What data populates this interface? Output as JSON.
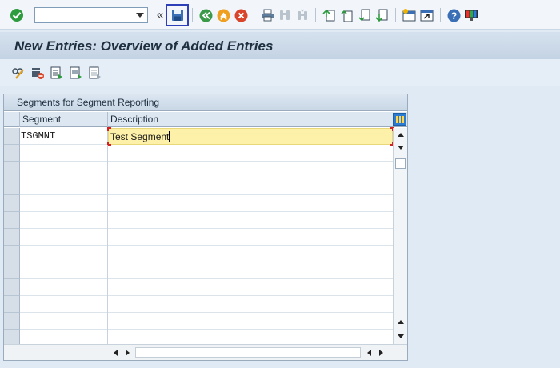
{
  "toolbar": {
    "command_field": {
      "value": "",
      "placeholder": ""
    },
    "collapse_glyph": "«",
    "icons": [
      "enter-icon",
      "save-icon",
      "back-icon",
      "exit-icon",
      "cancel-icon",
      "print-icon",
      "find-icon",
      "find-next-icon",
      "first-page-icon",
      "previous-page-icon",
      "next-page-icon",
      "last-page-icon",
      "create-session-icon",
      "shortcut-icon",
      "help-icon",
      "customize-layout-icon"
    ]
  },
  "title": {
    "text": "New Entries: Overview of Added Entries"
  },
  "app_toolbar": {
    "icons": [
      "change-display-icon",
      "delete-icon",
      "select-all-icon",
      "select-block-icon",
      "deselect-all-icon"
    ]
  },
  "table": {
    "title": "Segments for Segment Reporting",
    "columns": [
      "Segment",
      "Description"
    ],
    "rows": [
      {
        "segment": "TSGMNT",
        "description": "Test Segment"
      },
      {
        "segment": "",
        "description": ""
      },
      {
        "segment": "",
        "description": ""
      },
      {
        "segment": "",
        "description": ""
      },
      {
        "segment": "",
        "description": ""
      },
      {
        "segment": "",
        "description": ""
      },
      {
        "segment": "",
        "description": ""
      },
      {
        "segment": "",
        "description": ""
      },
      {
        "segment": "",
        "description": ""
      },
      {
        "segment": "",
        "description": ""
      },
      {
        "segment": "",
        "description": ""
      },
      {
        "segment": "",
        "description": ""
      },
      {
        "segment": "",
        "description": ""
      }
    ]
  },
  "colors": {
    "accent_frame": "#2c3fb8",
    "active_cell": "#fdf0a8",
    "enter_green": "#2e9b3f",
    "exit_orange": "#f0a020",
    "cancel_red": "#d8452a"
  }
}
